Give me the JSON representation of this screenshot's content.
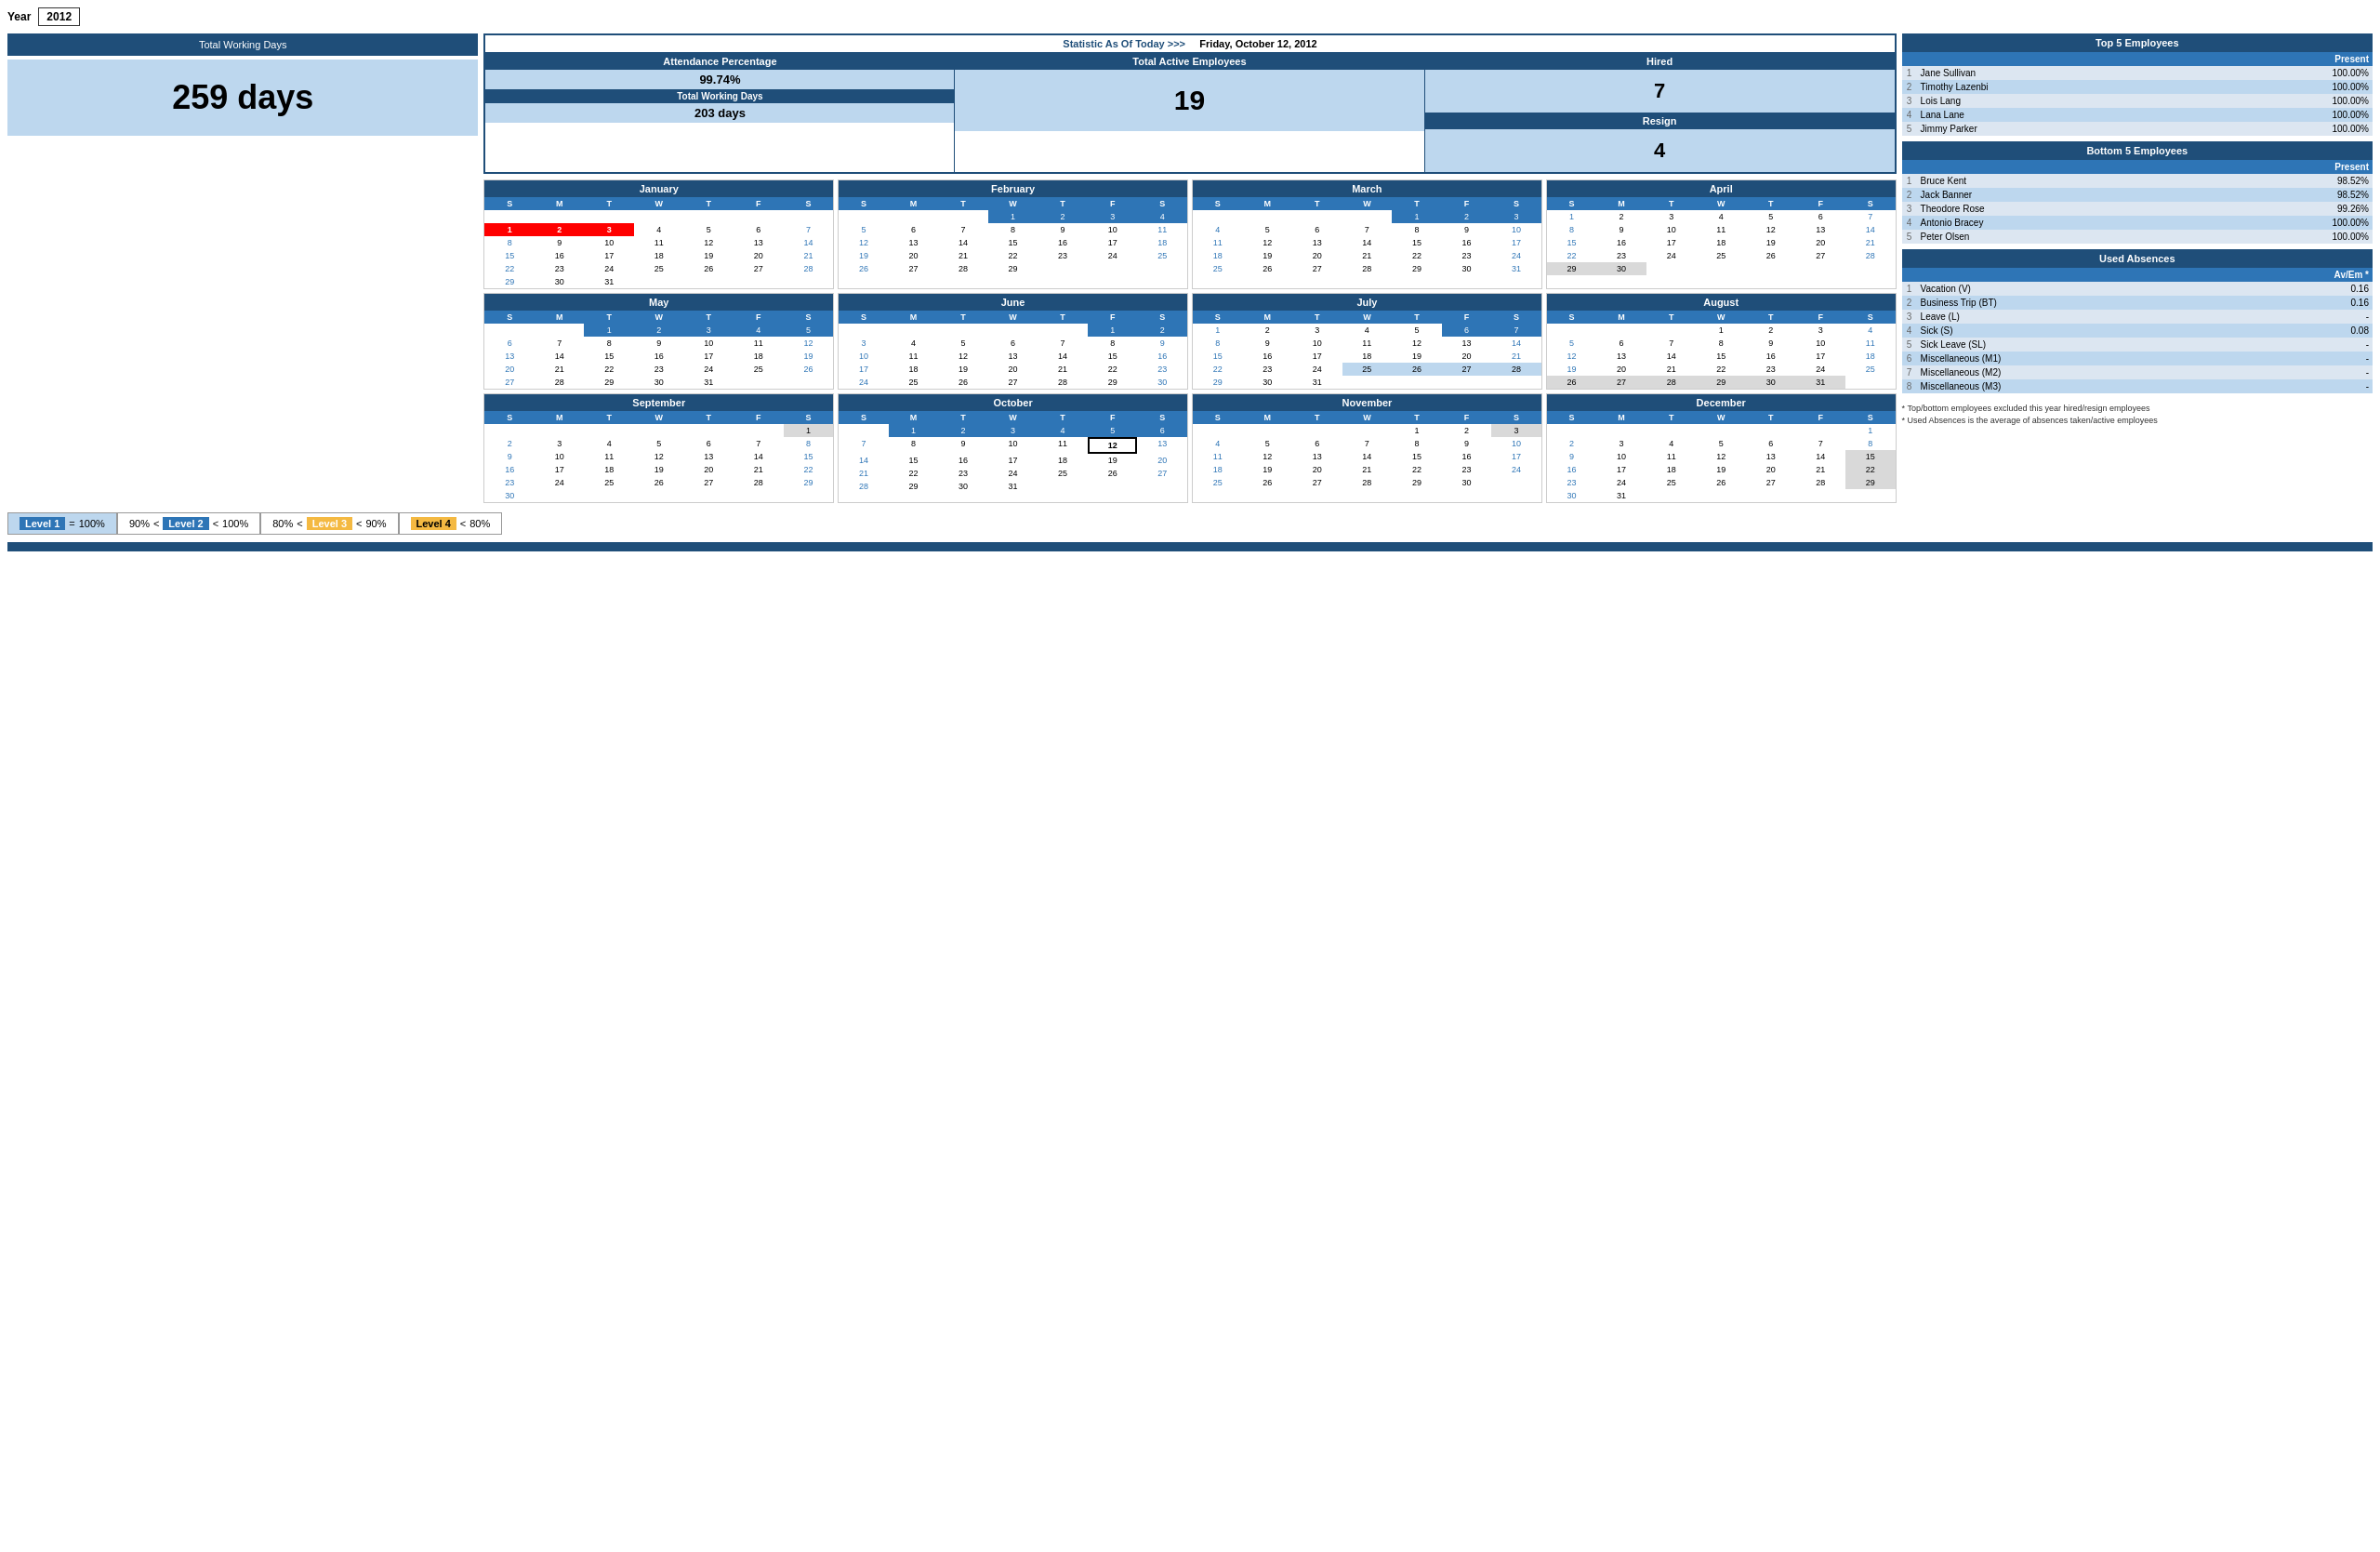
{
  "header": {
    "year_label": "Year",
    "year_value": "2012"
  },
  "total_working_days": {
    "title": "Total Working Days",
    "value": "259 days"
  },
  "stats": {
    "header": "Statistic As Of Today   >>>",
    "date": "Friday, October 12, 2012",
    "attendance_pct_label": "Attendance Percentage",
    "attendance_pct_value": "99.74%",
    "total_working_days_label": "Total Working Days",
    "total_working_days_value": "203 days",
    "total_active_label": "Total Active Employees",
    "total_active_value": "19",
    "hired_label": "Hired",
    "hired_value": "7",
    "resign_label": "Resign",
    "resign_value": "4"
  },
  "calendars": {
    "day_names": [
      "S",
      "M",
      "T",
      "W",
      "T",
      "F",
      "S"
    ],
    "months": [
      {
        "name": "January",
        "weeks": [
          [
            "",
            "",
            "",
            "",
            "",
            "",
            ""
          ],
          [
            "1",
            "2",
            "3",
            "4",
            "5",
            "6",
            "7"
          ],
          [
            "8",
            "9",
            "10",
            "11",
            "12",
            "13",
            "14"
          ],
          [
            "15",
            "16",
            "17",
            "18",
            "19",
            "20",
            "21"
          ],
          [
            "22",
            "23",
            "24",
            "25",
            "26",
            "27",
            "28"
          ],
          [
            "29",
            "30",
            "31",
            "",
            "",
            "",
            ""
          ]
        ],
        "highlights": {
          "red": [
            "1",
            "2",
            "3"
          ],
          "blue": [],
          "today": [],
          "gray": [],
          "lightblue": []
        }
      },
      {
        "name": "February",
        "weeks": [
          [
            "",
            "",
            "",
            "1",
            "2",
            "3",
            "4"
          ],
          [
            "5",
            "6",
            "7",
            "8",
            "9",
            "10",
            "11"
          ],
          [
            "12",
            "13",
            "14",
            "15",
            "16",
            "17",
            "18"
          ],
          [
            "19",
            "20",
            "21",
            "22",
            "23",
            "24",
            "25"
          ],
          [
            "26",
            "27",
            "28",
            "29",
            "",
            "",
            ""
          ]
        ],
        "highlights": {
          "red": [],
          "blue": [
            "1",
            "2",
            "3",
            "4"
          ],
          "today": [],
          "gray": [],
          "lightblue": []
        }
      },
      {
        "name": "March",
        "weeks": [
          [
            "",
            "",
            "",
            "",
            "1",
            "2",
            "3"
          ],
          [
            "4",
            "5",
            "6",
            "7",
            "8",
            "9",
            "10"
          ],
          [
            "11",
            "12",
            "13",
            "14",
            "15",
            "16",
            "17"
          ],
          [
            "18",
            "19",
            "20",
            "21",
            "22",
            "23",
            "24"
          ],
          [
            "25",
            "26",
            "27",
            "28",
            "29",
            "30",
            "31"
          ]
        ],
        "highlights": {
          "red": [],
          "blue": [
            "1",
            "2",
            "3"
          ],
          "today": [],
          "gray": [],
          "lightblue": []
        }
      },
      {
        "name": "April",
        "weeks": [
          [
            "1",
            "2",
            "3",
            "4",
            "5",
            "6",
            "7"
          ],
          [
            "8",
            "9",
            "10",
            "11",
            "12",
            "13",
            "14"
          ],
          [
            "15",
            "16",
            "17",
            "18",
            "19",
            "20",
            "21"
          ],
          [
            "22",
            "23",
            "24",
            "25",
            "26",
            "27",
            "28"
          ],
          [
            "29",
            "30",
            "",
            "",
            "",
            "",
            ""
          ]
        ],
        "highlights": {
          "red": [],
          "blue": [],
          "today": [],
          "gray": [
            "29",
            "30"
          ],
          "lightblue": []
        }
      },
      {
        "name": "May",
        "weeks": [
          [
            "",
            "",
            "1",
            "2",
            "3",
            "4",
            "5"
          ],
          [
            "6",
            "7",
            "8",
            "9",
            "10",
            "11",
            "12"
          ],
          [
            "13",
            "14",
            "15",
            "16",
            "17",
            "18",
            "19"
          ],
          [
            "20",
            "21",
            "22",
            "23",
            "24",
            "25",
            "26"
          ],
          [
            "27",
            "28",
            "29",
            "30",
            "31",
            "",
            ""
          ]
        ],
        "highlights": {
          "red": [],
          "blue": [
            "1",
            "2",
            "3",
            "4",
            "5"
          ],
          "today": [],
          "gray": [],
          "lightblue": []
        }
      },
      {
        "name": "June",
        "weeks": [
          [
            "",
            "",
            "",
            "",
            "",
            "1",
            "2"
          ],
          [
            "3",
            "4",
            "5",
            "6",
            "7",
            "8",
            "9"
          ],
          [
            "10",
            "11",
            "12",
            "13",
            "14",
            "15",
            "16"
          ],
          [
            "17",
            "18",
            "19",
            "20",
            "21",
            "22",
            "23"
          ],
          [
            "24",
            "25",
            "26",
            "27",
            "28",
            "29",
            "30"
          ]
        ],
        "highlights": {
          "red": [],
          "blue": [
            "1",
            "2"
          ],
          "today": [],
          "gray": [],
          "lightblue": []
        }
      },
      {
        "name": "July",
        "weeks": [
          [
            "1",
            "2",
            "3",
            "4",
            "5",
            "6",
            "7"
          ],
          [
            "8",
            "9",
            "10",
            "11",
            "12",
            "13",
            "14"
          ],
          [
            "15",
            "16",
            "17",
            "18",
            "19",
            "20",
            "21"
          ],
          [
            "22",
            "23",
            "24",
            "25",
            "26",
            "27",
            "28"
          ],
          [
            "29",
            "30",
            "31",
            "",
            "",
            "",
            ""
          ]
        ],
        "highlights": {
          "red": [],
          "blue": [
            "6",
            "7"
          ],
          "today": [],
          "gray": [],
          "lightblue": [
            "25",
            "26",
            "27",
            "28"
          ]
        }
      },
      {
        "name": "August",
        "weeks": [
          [
            "",
            "",
            "",
            "1",
            "2",
            "3",
            "4"
          ],
          [
            "5",
            "6",
            "7",
            "8",
            "9",
            "10",
            "11"
          ],
          [
            "12",
            "13",
            "14",
            "15",
            "16",
            "17",
            "18"
          ],
          [
            "19",
            "20",
            "21",
            "22",
            "23",
            "24",
            "25"
          ],
          [
            "26",
            "27",
            "28",
            "29",
            "30",
            "31",
            ""
          ]
        ],
        "highlights": {
          "red": [],
          "blue": [],
          "today": [],
          "gray": [
            "26",
            "27",
            "28",
            "29",
            "30",
            "31"
          ],
          "lightblue": []
        }
      },
      {
        "name": "September",
        "weeks": [
          [
            "",
            "",
            "",
            "",
            "",
            "",
            "1"
          ],
          [
            "2",
            "3",
            "4",
            "5",
            "6",
            "7",
            "8"
          ],
          [
            "9",
            "10",
            "11",
            "12",
            "13",
            "14",
            "15"
          ],
          [
            "16",
            "17",
            "18",
            "19",
            "20",
            "21",
            "22"
          ],
          [
            "23",
            "24",
            "25",
            "26",
            "27",
            "28",
            "29"
          ],
          [
            "30",
            "",
            "",
            "",
            "",
            "",
            ""
          ]
        ],
        "highlights": {
          "red": [],
          "blue": [],
          "today": [],
          "gray": [
            "1"
          ],
          "lightblue": []
        }
      },
      {
        "name": "October",
        "weeks": [
          [
            "",
            "1",
            "2",
            "3",
            "4",
            "5",
            "6"
          ],
          [
            "7",
            "8",
            "9",
            "10",
            "11",
            "12",
            "13"
          ],
          [
            "14",
            "15",
            "16",
            "17",
            "18",
            "19",
            "20"
          ],
          [
            "21",
            "22",
            "23",
            "24",
            "25",
            "26",
            "27"
          ],
          [
            "28",
            "29",
            "30",
            "31",
            "",
            "",
            ""
          ]
        ],
        "highlights": {
          "red": [],
          "blue": [
            "1",
            "2",
            "3",
            "4",
            "5",
            "6"
          ],
          "today": [
            "12"
          ],
          "gray": [],
          "lightblue": []
        }
      },
      {
        "name": "November",
        "weeks": [
          [
            "",
            "",
            "",
            "",
            "1",
            "2",
            "3"
          ],
          [
            "4",
            "5",
            "6",
            "7",
            "8",
            "9",
            "10"
          ],
          [
            "11",
            "12",
            "13",
            "14",
            "15",
            "16",
            "17"
          ],
          [
            "18",
            "19",
            "20",
            "21",
            "22",
            "23",
            "24"
          ],
          [
            "25",
            "26",
            "27",
            "28",
            "29",
            "30",
            ""
          ]
        ],
        "highlights": {
          "red": [],
          "blue": [],
          "today": [],
          "gray": [
            "3"
          ],
          "lightblue": []
        }
      },
      {
        "name": "December",
        "weeks": [
          [
            "",
            "",
            "",
            "",
            "",
            "",
            "1"
          ],
          [
            "2",
            "3",
            "4",
            "5",
            "6",
            "7",
            "8"
          ],
          [
            "9",
            "10",
            "11",
            "12",
            "13",
            "14",
            "15"
          ],
          [
            "16",
            "17",
            "18",
            "19",
            "20",
            "21",
            "22"
          ],
          [
            "23",
            "24",
            "25",
            "26",
            "27",
            "28",
            "29"
          ],
          [
            "30",
            "31",
            "",
            "",
            "",
            "",
            ""
          ]
        ],
        "highlights": {
          "red": [],
          "blue": [],
          "today": [],
          "gray": [
            "15",
            "22",
            "29"
          ],
          "lightblue": []
        }
      }
    ]
  },
  "top5": {
    "title": "Top 5 Employees",
    "col_header": "Present",
    "employees": [
      {
        "rank": "1",
        "name": "Jane Sullivan",
        "value": "100.00%"
      },
      {
        "rank": "2",
        "name": "Timothy Lazenbi",
        "value": "100.00%"
      },
      {
        "rank": "3",
        "name": "Lois Lang",
        "value": "100.00%"
      },
      {
        "rank": "4",
        "name": "Lana Lane",
        "value": "100.00%"
      },
      {
        "rank": "5",
        "name": "Jimmy Parker",
        "value": "100.00%"
      }
    ]
  },
  "bottom5": {
    "title": "Bottom 5 Employees",
    "col_header": "Present",
    "employees": [
      {
        "rank": "1",
        "name": "Bruce Kent",
        "value": "98.52%"
      },
      {
        "rank": "2",
        "name": "Jack Banner",
        "value": "98.52%"
      },
      {
        "rank": "3",
        "name": "Theodore Rose",
        "value": "99.26%"
      },
      {
        "rank": "4",
        "name": "Antonio Bracey",
        "value": "100.00%"
      },
      {
        "rank": "5",
        "name": "Peter Olsen",
        "value": "100.00%"
      }
    ]
  },
  "used_absences": {
    "title": "Used Absences",
    "col_header": "Av/Em *",
    "items": [
      {
        "rank": "1",
        "name": "Vacation (V)",
        "value": "0.16"
      },
      {
        "rank": "2",
        "name": "Business Trip (BT)",
        "value": "0.16"
      },
      {
        "rank": "3",
        "name": "Leave (L)",
        "value": "-"
      },
      {
        "rank": "4",
        "name": "Sick (S)",
        "value": "0.08"
      },
      {
        "rank": "5",
        "name": "Sick Leave (SL)",
        "value": "-"
      },
      {
        "rank": "6",
        "name": "Miscellaneous (M1)",
        "value": "-"
      },
      {
        "rank": "7",
        "name": "Miscellaneous (M2)",
        "value": "-"
      },
      {
        "rank": "8",
        "name": "Miscellaneous (M3)",
        "value": "-"
      }
    ]
  },
  "footnotes": {
    "line1": "* Top/bottom employees excluded this year hired/resign employees",
    "line2": "* Used Absences is the average of absences taken/active employees"
  },
  "legend": {
    "level1_label": "Level 1",
    "level1_eq": "=",
    "level1_val": "100%",
    "level2_lo": "90%",
    "level2_lt1": "<",
    "level2_label": "Level 2",
    "level2_lt2": "<",
    "level2_hi": "100%",
    "level3_lo": "80%",
    "level3_lt1": "<",
    "level3_label": "Level 3",
    "level3_lt2": "<",
    "level3_hi": "90%",
    "level4_label": "Level 4",
    "level4_lt": "<",
    "level4_val": "80%"
  }
}
